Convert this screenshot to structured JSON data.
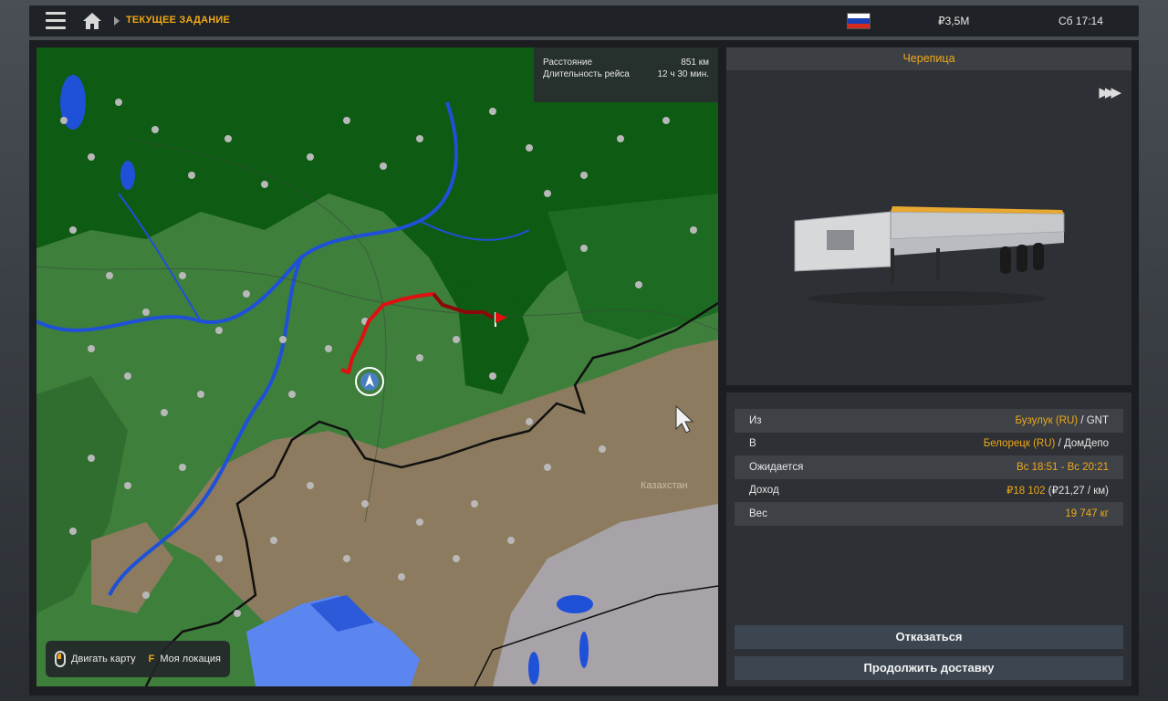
{
  "topbar": {
    "breadcrumb": "ТЕКУЩЕЕ ЗАДАНИЕ",
    "money": "₽3,5M",
    "clock": "Сб 17:14",
    "flag_colors": [
      "#ffffff",
      "#1a3fb0",
      "#d52b1e"
    ]
  },
  "map": {
    "distance_label": "Расстояние",
    "distance_value": "851 км",
    "duration_label": "Длительность рейса",
    "duration_value": "12 ч 30 мин.",
    "country_label": "Казахстан",
    "hint_move": "Двигать карту",
    "hint_key": "F",
    "hint_location": "Моя локация",
    "colors": {
      "forest": "#0e5b14",
      "green": "#3e7f3c",
      "steppe": "#8c7b5e",
      "water": "#1f50d8",
      "route": "#e01010",
      "border": "#101010"
    }
  },
  "cargo": {
    "title": "Черепица",
    "forward_icon": "fast-forward-icon"
  },
  "details": {
    "from_label": "Из",
    "from_city": "Бузулук (RU)",
    "from_company": " / GNT",
    "to_label": "В",
    "to_city": "Белорецк (RU)",
    "to_company": " / ДомДепо",
    "expected_label": "Ожидается",
    "expected_value": "Вс 18:51 - Вс 20:21",
    "income_label": "Доход",
    "income_value": "₽18 102",
    "income_rate": " (₽21,27 / км)",
    "weight_label": "Вес",
    "weight_value": "19 747 кг"
  },
  "buttons": {
    "cancel": "Отказаться",
    "continue": "Продолжить доставку"
  },
  "accent_color": "#f0a818"
}
